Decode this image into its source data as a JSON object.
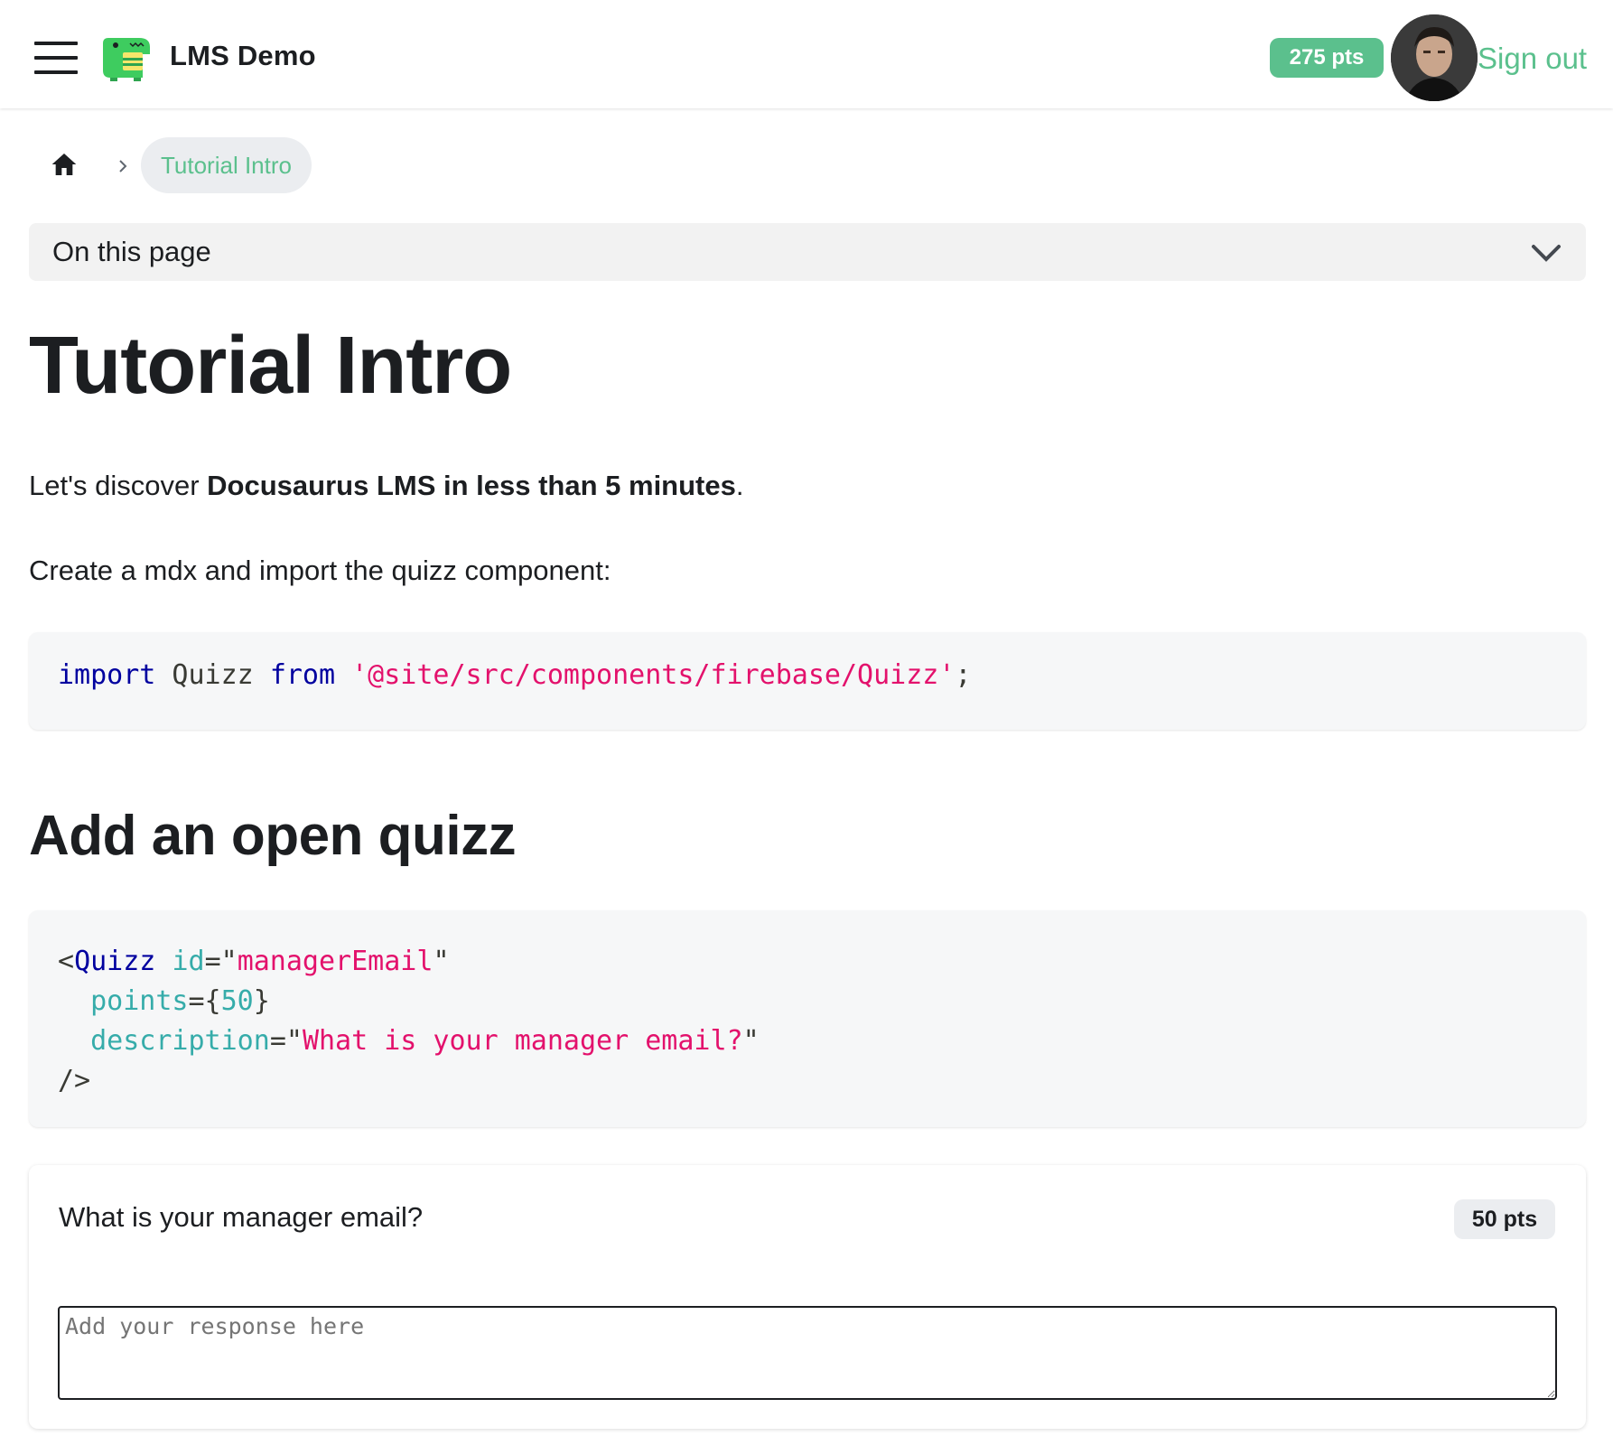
{
  "navbar": {
    "brand": "LMS Demo",
    "points": "275 pts",
    "sign_out": "Sign out",
    "menu_icon": "hamburger-icon",
    "logo_icon": "dinosaur-logo",
    "avatar": "user-avatar"
  },
  "breadcrumb": {
    "home_icon": "home-icon",
    "separator_icon": "chevron-right-icon",
    "current": "Tutorial Intro"
  },
  "toc": {
    "label": "On this page",
    "icon": "chevron-down-icon"
  },
  "content": {
    "title": "Tutorial Intro",
    "intro_prefix": "Let's discover ",
    "intro_bold": "Docusaurus LMS in less than 5 minutes",
    "intro_suffix": ".",
    "instruction": "Create a mdx and import the quizz component:",
    "code_import": {
      "kw_import": "import",
      "ident": " Quizz ",
      "kw_from": "from",
      "path": " '@site/src/components/firebase/Quizz'",
      "semi": ";"
    },
    "section_heading": "Add an open quizz",
    "code_quizz": {
      "open": "<",
      "tag": "Quizz",
      "attr_id": "id",
      "val_id": "managerEmail",
      "attr_points": "points",
      "val_points": "50",
      "attr_desc": "description",
      "val_desc": "What is your manager email?",
      "close": "/>"
    }
  },
  "quiz": {
    "question": "What is your manager email?",
    "points": "50 pts",
    "placeholder": "Add your response here"
  },
  "colors": {
    "accent": "#5bc08d",
    "code_keyword": "#00009f",
    "code_string": "#e3116c",
    "code_attr": "#36acaa"
  }
}
